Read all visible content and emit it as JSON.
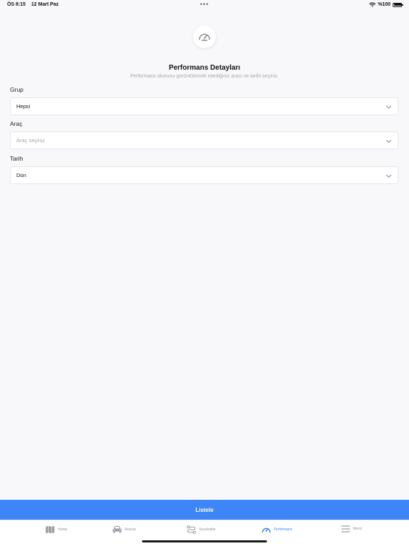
{
  "status_bar": {
    "time": "ÖS 8:15",
    "date": "12 Mart Paz",
    "dots": "•••",
    "battery": "%100"
  },
  "hero": {
    "icon": "speedometer-icon",
    "title": "Performans Detayları",
    "subtitle": "Performans skorunu görüntülemek istediğiniz aracı ve tarihi seçiniz."
  },
  "form": {
    "group": {
      "label": "Grup",
      "value": "Hepsi"
    },
    "vehicle": {
      "label": "Araç",
      "placeholder": "Araç seçiniz"
    },
    "date": {
      "label": "Tarih",
      "value": "Dün"
    }
  },
  "actions": {
    "list_label": "Listele"
  },
  "tabs": [
    {
      "label": "Harita",
      "icon": "map-icon",
      "active": false
    },
    {
      "label": "Araçlar",
      "icon": "car-icon",
      "active": false
    },
    {
      "label": "Seyahatler",
      "icon": "route-icon",
      "active": false
    },
    {
      "label": "Performans",
      "icon": "speedometer-icon",
      "active": true
    },
    {
      "label": "Menü",
      "icon": "menu-icon",
      "active": false
    }
  ],
  "colors": {
    "accent": "#3d86f7",
    "background": "#f8f8fa",
    "inactive_tab": "#9a9aa2"
  }
}
